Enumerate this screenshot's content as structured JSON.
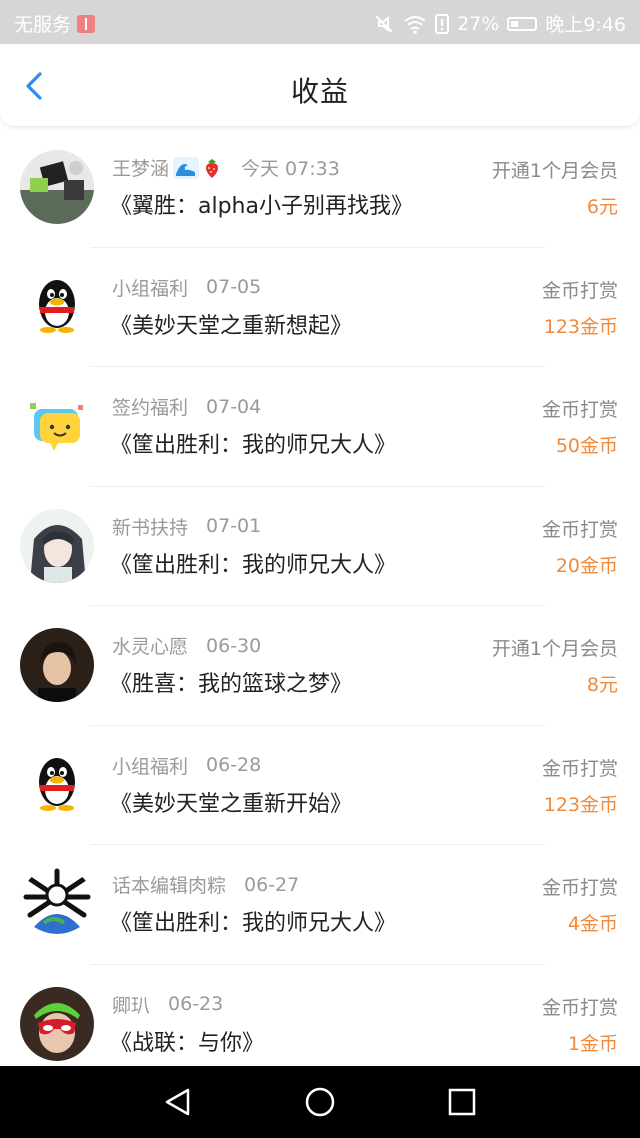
{
  "status_bar": {
    "carrier": "无服务",
    "battery": "27%",
    "time": "晚上9:46"
  },
  "header": {
    "title": "收益"
  },
  "colors": {
    "accent": "#2d8cf0",
    "amount": "#f08a3c"
  },
  "rows": [
    {
      "name": "王梦涵",
      "date": "今天 07:33",
      "kind": "开通1个月会员",
      "book": "《翼胜：alpha小子别再找我》",
      "amount": "6元",
      "avatar": "photo-collage",
      "emoji": [
        "wave-emoji",
        "strawberry-emoji"
      ]
    },
    {
      "name": "小组福利",
      "date": "07-05",
      "kind": "金币打赏",
      "book": "《美妙天堂之重新想起》",
      "amount": "123金币",
      "avatar": "qq-penguin"
    },
    {
      "name": "签约福利",
      "date": "07-04",
      "kind": "金币打赏",
      "book": "《筐出胜利：我的师兄大人》",
      "amount": "50金币",
      "avatar": "chat-bubble"
    },
    {
      "name": "新书扶持",
      "date": "07-01",
      "kind": "金币打赏",
      "book": "《筐出胜利：我的师兄大人》",
      "amount": "20金币",
      "avatar": "anime-portrait"
    },
    {
      "name": "水灵心愿",
      "date": "06-30",
      "kind": "开通1个月会员",
      "book": "《胜喜：我的篮球之梦》",
      "amount": "8元",
      "avatar": "person-photo"
    },
    {
      "name": "小组福利",
      "date": "06-28",
      "kind": "金币打赏",
      "book": "《美妙天堂之重新开始》",
      "amount": "123金币",
      "avatar": "qq-penguin"
    },
    {
      "name": "话本编辑肉粽",
      "date": "06-27",
      "kind": "金币打赏",
      "book": "《筐出胜利：我的师兄大人》",
      "amount": "4金币",
      "avatar": "skull-globe"
    },
    {
      "name": "卿玐",
      "date": "06-23",
      "kind": "金币打赏",
      "book": "《战联：与你》",
      "amount": "1金币",
      "avatar": "person-sunglasses"
    }
  ]
}
